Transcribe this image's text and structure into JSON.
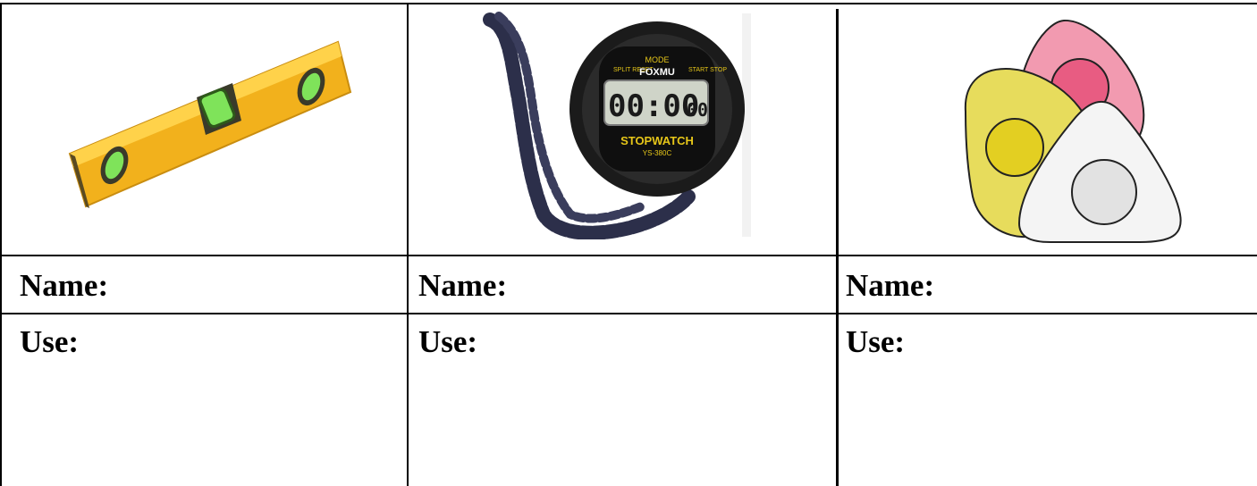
{
  "worksheet": {
    "tools": [
      {
        "image_icon": "spirit-level-icon",
        "name_label": "Name:",
        "use_label": "Use:"
      },
      {
        "image_icon": "stopwatch-icon",
        "name_label": "Name:",
        "use_label": "Use:"
      },
      {
        "image_icon": "tailor-chalk-icon",
        "name_label": "Name:",
        "use_label": "Use:"
      }
    ],
    "stopwatch": {
      "brand": "FOXMU",
      "display": "00:00",
      "display_small": "00",
      "face_text": "STOPWATCH",
      "model": "YS-380C",
      "button_mode": "MODE",
      "button_split": "SPLIT RESET",
      "button_start": "START STOP"
    },
    "colors": {
      "border": "#000000",
      "level_yellow": "#f2b11c",
      "level_bubble": "#7fe35a",
      "chalk_pink": "#f29ab0",
      "chalk_yellow": "#e7dc5c",
      "chalk_white": "#f4f4f4"
    }
  }
}
